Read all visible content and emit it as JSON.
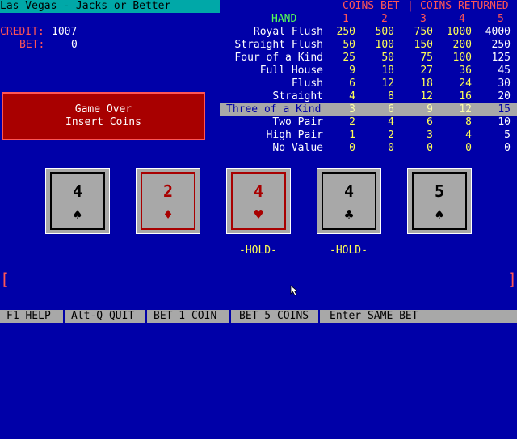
{
  "title": "Las Vegas - Jacks or Better",
  "credit_label": "CREDIT:",
  "credit_value": "1007",
  "bet_label": "BET:",
  "bet_value": "0",
  "message": {
    "line1": "Game Over",
    "line2": "Insert Coins"
  },
  "paytable": {
    "header_left": "COINS BET",
    "header_sep": "|",
    "header_right": "COINS RETURNED",
    "hand_header": "HAND",
    "coin_columns": [
      "1",
      "2",
      "3",
      "4",
      "5"
    ],
    "highlighted_row": "Three of a Kind",
    "rows": [
      {
        "hand": "Royal Flush",
        "values": [
          "250",
          "500",
          "750",
          "1000",
          "4000"
        ]
      },
      {
        "hand": "Straight Flush",
        "values": [
          "50",
          "100",
          "150",
          "200",
          "250"
        ]
      },
      {
        "hand": "Four of a Kind",
        "values": [
          "25",
          "50",
          "75",
          "100",
          "125"
        ]
      },
      {
        "hand": "Full House",
        "values": [
          "9",
          "18",
          "27",
          "36",
          "45"
        ]
      },
      {
        "hand": "Flush",
        "values": [
          "6",
          "12",
          "18",
          "24",
          "30"
        ]
      },
      {
        "hand": "Straight",
        "values": [
          "4",
          "8",
          "12",
          "16",
          "20"
        ]
      },
      {
        "hand": "Three of a Kind",
        "values": [
          "3",
          "6",
          "9",
          "12",
          "15"
        ]
      },
      {
        "hand": "Two Pair",
        "values": [
          "2",
          "4",
          "6",
          "8",
          "10"
        ]
      },
      {
        "hand": "High Pair",
        "values": [
          "1",
          "2",
          "3",
          "4",
          "5"
        ]
      },
      {
        "hand": "No Value",
        "values": [
          "0",
          "0",
          "0",
          "0",
          "0"
        ]
      }
    ]
  },
  "cards": [
    {
      "rank": "4",
      "suit": "♠",
      "suit_name": "spades",
      "color": "black",
      "hold": ""
    },
    {
      "rank": "2",
      "suit": "♦",
      "suit_name": "diamonds",
      "color": "red",
      "hold": ""
    },
    {
      "rank": "4",
      "suit": "♥",
      "suit_name": "hearts",
      "color": "red",
      "hold": "-HOLD-"
    },
    {
      "rank": "4",
      "suit": "♣",
      "suit_name": "clubs",
      "color": "black",
      "hold": "-HOLD-"
    },
    {
      "rank": "5",
      "suit": "♠",
      "suit_name": "spades",
      "color": "black",
      "hold": ""
    }
  ],
  "brackets": {
    "left": "[",
    "right": "]"
  },
  "footer": [
    "F1 HELP",
    "Alt-Q QUIT",
    "BET 1 COIN",
    "BET 5 COINS",
    "Enter SAME BET"
  ],
  "colors": {
    "background": "#0000a8",
    "accent_red": "#ff5555",
    "title_bar": "#00a8a8",
    "values_yellow": "#ffff55"
  }
}
